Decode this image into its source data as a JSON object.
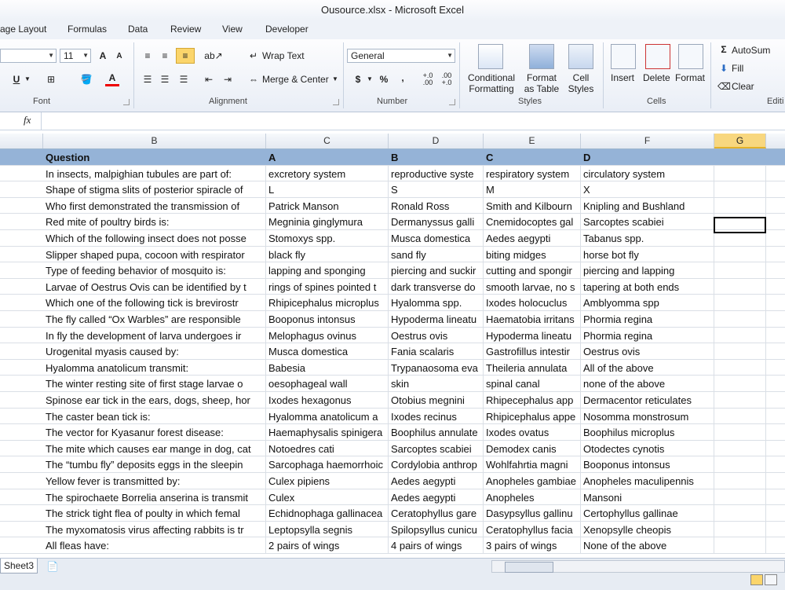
{
  "window": {
    "title": "Ousource.xlsx  -  Microsoft Excel"
  },
  "ribbon_tabs": [
    "age Layout",
    "Formulas",
    "Data",
    "Review",
    "View",
    "Developer"
  ],
  "font_group": {
    "label": "Font",
    "font_size": "11",
    "grow_label": "A",
    "shrink_label": "A",
    "underline_label": "U",
    "font_color_label": "A"
  },
  "alignment_group": {
    "label": "Alignment",
    "wrap_text": "Wrap Text",
    "merge_center": "Merge & Center"
  },
  "number_group": {
    "label": "Number",
    "format": "General",
    "currency": "$",
    "percent": "%",
    "comma": ",",
    "inc_decimal": "+.0 .00",
    "dec_decimal": ".00 +.0"
  },
  "styles_group": {
    "label": "Styles",
    "conditional_line1": "Conditional",
    "conditional_line2": "Formatting",
    "format_table_line1": "Format",
    "format_table_line2": "as Table",
    "cell_styles_line1": "Cell",
    "cell_styles_line2": "Styles"
  },
  "cells_group": {
    "label": "Cells",
    "insert": "Insert",
    "delete": "Delete",
    "format": "Format"
  },
  "editing_group": {
    "label": "Editi",
    "autosum": "AutoSum",
    "fill": "Fill",
    "clear": "Clear"
  },
  "formula_bar": {
    "fx": "fx",
    "value": ""
  },
  "columns": [
    "B",
    "C",
    "D",
    "E",
    "F",
    "G"
  ],
  "selected_column": "G",
  "header_row": [
    "Question",
    "A",
    "B",
    "C",
    "D"
  ],
  "rows": [
    [
      "In insects, malpighian tubules are part of:",
      " excretory system",
      " reproductive syste",
      " respiratory system",
      "circulatory system"
    ],
    [
      "Shape of stigma slits of posterior spiracle of",
      "L",
      "S",
      "M",
      "X"
    ],
    [
      "Who first demonstrated the transmission of",
      " Patrick Manson",
      "Ronald Ross",
      "Smith and Kilbourn",
      "Knipling and Bushland"
    ],
    [
      "Red mite of poultry birds is:",
      "Megninia ginglymura",
      " Dermanyssus galli",
      "Cnemidocoptes gal",
      "Sarcoptes scabiei"
    ],
    [
      "Which of the following insect does not posse",
      "Stomoxys spp.",
      " Musca domestica",
      " Aedes aegypti",
      "Tabanus spp."
    ],
    [
      "Slipper shaped pupa, cocoon with respirator",
      "black fly",
      " sand fly",
      " biting midges",
      "horse bot fly"
    ],
    [
      "Type of feeding behavior of mosquito is:",
      "lapping and sponging",
      "piercing and suckir",
      "cutting and spongir",
      "piercing and lapping"
    ],
    [
      "Larvae of Oestrus Ovis can be identified by t",
      "rings of spines pointed t",
      "dark transverse do",
      "smooth larvae, no s",
      "tapering at both ends"
    ],
    [
      "Which one of the following tick is brevirostr",
      "Rhipicephalus microplus",
      "Hyalomma spp.",
      " Ixodes holocuclus",
      "Amblyomma spp"
    ],
    [
      "The fly called “Ox Warbles” are responsible",
      "Booponus intonsus",
      "Hypoderma lineatu",
      "Haematobia irritans",
      "Phormia regina"
    ],
    [
      "In fly the development of larva undergoes ir",
      "Melophagus ovinus",
      "Oestrus ovis",
      "Hypoderma lineatu",
      "Phormia regina"
    ],
    [
      "Urogenital myasis caused by:",
      "Musca domestica",
      "Fania scalaris",
      "Gastrofillus intestir",
      "Oestrus ovis"
    ],
    [
      "Hyalomma anatolicum transmit:",
      "Babesia",
      "Trypanaosoma eva",
      "Theileria annulata",
      "All of the above"
    ],
    [
      "The winter resting site of first stage larvae o",
      "oesophageal wall",
      "skin",
      "spinal canal",
      "none of the above"
    ],
    [
      "Spinose ear tick in the ears, dogs, sheep, hor",
      "Ixodes hexagonus",
      "Otobius megnini",
      "Rhipecephalus app",
      "Dermacentor reticulates"
    ],
    [
      "The caster bean tick is:",
      "Hyalomma anatolicum a",
      "Ixodes recinus",
      "Rhipicephalus appe",
      "Nosomma monstrosum"
    ],
    [
      "The vector for Kyasanur forest disease:",
      "Haemaphysalis spinigera",
      "Boophilus annulate",
      "Ixodes ovatus",
      "Boophilus microplus"
    ],
    [
      "The mite which causes ear mange in dog, cat",
      "Notoedres cati",
      "Sarcoptes scabiei",
      "Demodex canis",
      "Otodectes cynotis"
    ],
    [
      "The “tumbu fly” deposits eggs in the sleepin",
      "Sarcophaga haemorrhoic",
      "Cordylobia anthrop",
      " Wohlfahrtia magni",
      "Booponus intonsus"
    ],
    [
      "Yellow fever is transmitted by:",
      "Culex pipiens",
      "Aedes aegypti",
      "Anopheles gambiae",
      "Anopheles maculipennis"
    ],
    [
      "The spirochaete Borrelia anserina is transmit",
      "Culex",
      "Aedes aegypti",
      "Anopheles",
      "Mansoni"
    ],
    [
      "The strick tight flea of poulty in which femal",
      "Echidnophaga gallinacea",
      "Ceratophyllus gare",
      "Dasypsyllus gallinu",
      "Certophyllus gallinae"
    ],
    [
      "The myxomatosis virus affecting rabbits is tr",
      "Leptopsylla segnis",
      "Spilopsyllus cunicu",
      "Ceratophyllus facia",
      "Xenopsylle cheopis"
    ],
    [
      "All fleas have:",
      "2 pairs of wings",
      "4 pairs of wings",
      "3 pairs of wings",
      "None of the above"
    ]
  ],
  "sheet_tab": "Sheet3",
  "colors": {
    "header_fill": "#95b3d7",
    "selected_col": "#f8d77f"
  }
}
